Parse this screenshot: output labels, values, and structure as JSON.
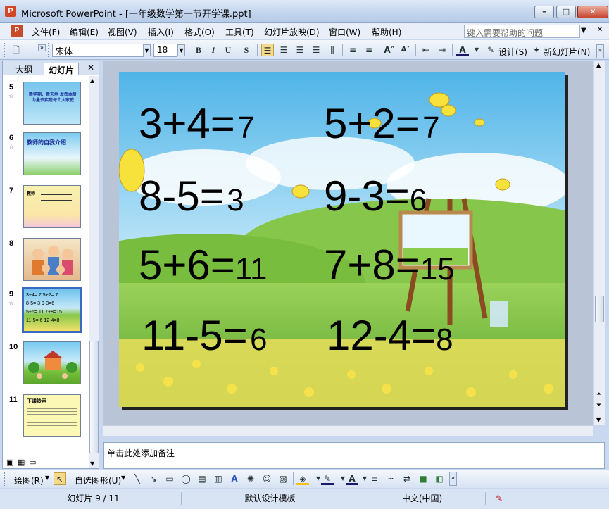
{
  "window": {
    "title": "Microsoft PowerPoint - [一年级数学第一节开学课.ppt]",
    "minimize": "–",
    "maximize": "□",
    "close": "✕"
  },
  "menu": {
    "items": [
      "文件(F)",
      "编辑(E)",
      "视图(V)",
      "插入(I)",
      "格式(O)",
      "工具(T)",
      "幻灯片放映(D)",
      "窗口(W)",
      "帮助(H)"
    ],
    "help_placeholder": "键入需要帮助的问题"
  },
  "toolbar": {
    "font_name": "宋体",
    "font_size": "18",
    "bold": "B",
    "italic": "I",
    "underline": "U",
    "shadow": "S",
    "design_label": "设计(S)",
    "new_slide_label": "新幻灯片(N)"
  },
  "left_pane": {
    "tabs": [
      "大纲",
      "幻灯片"
    ],
    "active_tab": "幻灯片",
    "thumbnails": [
      {
        "number": "5",
        "has_star": true,
        "title": "新学期、新天地 发挥本身力量去实现每个大家庭"
      },
      {
        "number": "6",
        "has_star": true,
        "title": "教师的自我介绍"
      },
      {
        "number": "7",
        "has_star": false,
        "title": "教师"
      },
      {
        "number": "8",
        "has_star": false,
        "title": ""
      },
      {
        "number": "9",
        "has_star": true,
        "title": "",
        "selected": true
      },
      {
        "number": "10",
        "has_star": false,
        "title": ""
      },
      {
        "number": "11",
        "has_star": false,
        "title": "下课铃声"
      }
    ]
  },
  "slide": {
    "equations": [
      {
        "expr": "3+4=",
        "answer": "7"
      },
      {
        "expr": "5+2=",
        "answer": "7"
      },
      {
        "expr": "8-5=",
        "answer": "3"
      },
      {
        "expr": "9-3=",
        "answer": "6"
      },
      {
        "expr": "5+6=",
        "answer": "11"
      },
      {
        "expr": "7+8=",
        "answer": "15"
      },
      {
        "expr": "11-5=",
        "answer": "6"
      },
      {
        "expr": "12-4=",
        "answer": "8"
      }
    ],
    "thumb9_lines": [
      "3+4= 7  5+2= 7",
      "8-5= 3  9-3=6",
      "5+6= 11 7+8=15",
      "11-5= 6 12-4=8"
    ]
  },
  "notes": {
    "placeholder": "单击此处添加备注"
  },
  "drawing_toolbar": {
    "draw_label": "绘图(R)",
    "autoshapes_label": "自选图形(U)"
  },
  "status": {
    "slide_position": "幻灯片 9 / 11",
    "template": "默认设计模板",
    "language": "中文(中国)"
  },
  "colors": {
    "sky": "#6ec4ec",
    "grass": "#7cbf3a",
    "selection": "#3a6bc0"
  }
}
